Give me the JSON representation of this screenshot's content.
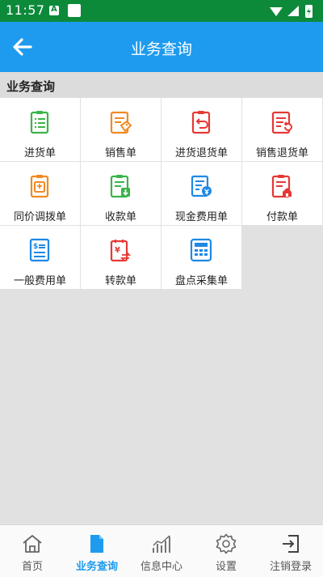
{
  "status_bar": {
    "time": "11:57",
    "a_icon": "A"
  },
  "app_bar": {
    "title": "业务查询",
    "back_icon": "arrow-left-icon"
  },
  "section": {
    "title": "业务查询"
  },
  "tiles": [
    {
      "label": "进货单",
      "icon": "purchase-order-icon",
      "color": "#3cb34a"
    },
    {
      "label": "销售单",
      "icon": "sales-order-icon",
      "color": "#f08a24"
    },
    {
      "label": "进货退货单",
      "icon": "purchase-return-icon",
      "color": "#e53935"
    },
    {
      "label": "销售退货单",
      "icon": "sales-return-icon",
      "color": "#e53935"
    },
    {
      "label": "同价调拨单",
      "icon": "transfer-order-icon",
      "color": "#f08a24"
    },
    {
      "label": "收款单",
      "icon": "receipt-icon",
      "color": "#3cb34a"
    },
    {
      "label": "现金费用单",
      "icon": "cash-expense-icon",
      "color": "#1e88e5"
    },
    {
      "label": "付款单",
      "icon": "payment-icon",
      "color": "#e53935"
    },
    {
      "label": "一般费用单",
      "icon": "general-expense-icon",
      "color": "#1e88e5"
    },
    {
      "label": "转款单",
      "icon": "transfer-money-icon",
      "color": "#e53935"
    },
    {
      "label": "盘点采集单",
      "icon": "inventory-count-icon",
      "color": "#1e88e5"
    }
  ],
  "bottom_nav": [
    {
      "label": "首页",
      "icon": "home-icon"
    },
    {
      "label": "业务查询",
      "icon": "document-icon",
      "active": true
    },
    {
      "label": "信息中心",
      "icon": "chart-icon"
    },
    {
      "label": "设置",
      "icon": "gear-icon"
    },
    {
      "label": "注销登录",
      "icon": "logout-icon"
    }
  ],
  "colors": {
    "accent": "#1e9bef",
    "status_bar": "#0c8a3a"
  }
}
